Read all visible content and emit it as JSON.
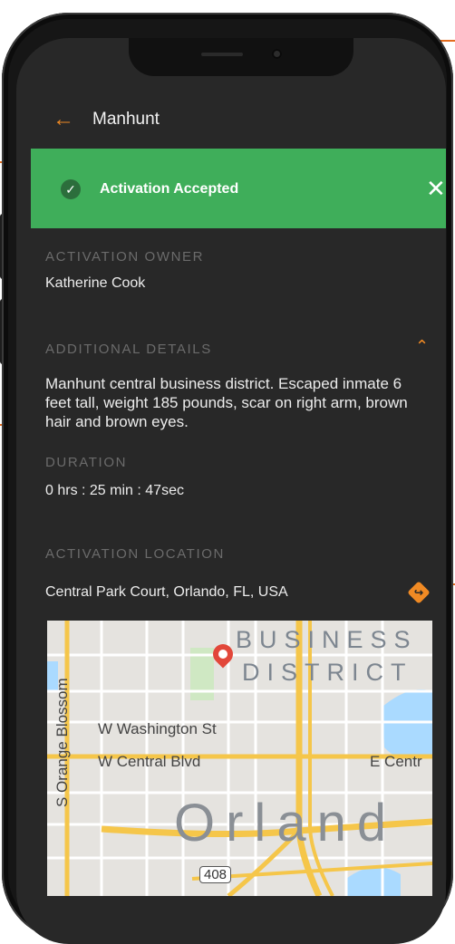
{
  "header": {
    "title": "Manhunt",
    "back_icon": "arrow-left-icon"
  },
  "banner": {
    "text": "Activation Accepted",
    "color": "#3fae5a"
  },
  "owner": {
    "label": "ACTIVATION OWNER",
    "value": "Katherine Cook"
  },
  "details": {
    "label": "ADDITIONAL DETAILS",
    "text": "Manhunt central business district. Escaped inmate 6 feet tall, weight 185 pounds, scar on right arm, brown hair and brown eyes."
  },
  "duration": {
    "label": "DURATION",
    "value": "0 hrs : 25 min : 47sec"
  },
  "location": {
    "label": "ACTIVATION LOCATION",
    "address": "Central Park Court, Orlando, FL, USA"
  },
  "map": {
    "district_line1": "BUSINESS",
    "district_line2": "DISTRICT",
    "street1": "W Washington St",
    "street2": "W Central Blvd",
    "street3": "E Centr",
    "street_vertical": "S Orange Blossom",
    "city": "Orland",
    "route": "408"
  },
  "colors": {
    "accent": "#f08a24",
    "success": "#3fae5a",
    "background": "#282828"
  }
}
